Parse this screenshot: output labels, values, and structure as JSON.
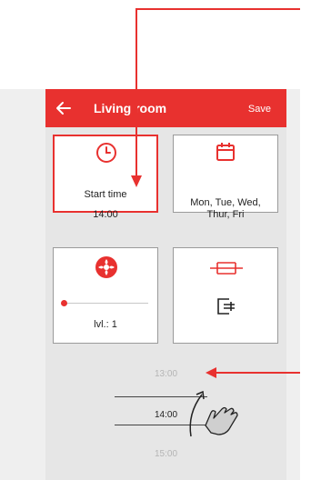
{
  "appbar": {
    "title": "Living room",
    "save_label": "Save",
    "back_icon": "arrow-left-icon"
  },
  "cards": {
    "start_time": {
      "label": "Start time",
      "value": "14:00",
      "icon": "clock-icon"
    },
    "days": {
      "label": "Mon, Tue, Wed, Thur, Fri",
      "icon": "calendar-icon"
    },
    "level": {
      "label": "lvl.: 1",
      "icon": "fan-icon",
      "slider_value": 0.0
    },
    "bypass": {
      "icon_top": "expand-arrows-icon",
      "icon_bottom": "bypass-icon"
    }
  },
  "time_wheel": {
    "prev": "13:00",
    "current": "14:00",
    "next": "15:00"
  },
  "colors": {
    "accent": "#e8312f",
    "panel": "#e6e6e6",
    "muted_text": "#b5b5b5"
  }
}
